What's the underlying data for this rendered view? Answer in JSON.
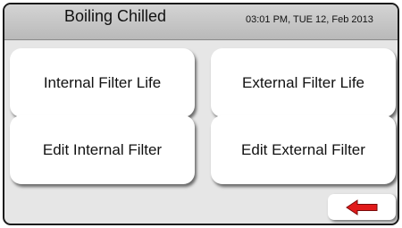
{
  "header": {
    "title": "Boiling Chilled",
    "datetime": "03:01 PM, TUE 12, Feb 2013"
  },
  "menu": {
    "internal_filter_life": "Internal Filter Life",
    "external_filter_life": "External Filter Life",
    "edit_internal_filter": "Edit Internal Filter",
    "edit_external_filter": "Edit External Filter"
  },
  "footer": {
    "back_icon": "arrow-left-icon",
    "back_icon_color": "#e11a1a"
  }
}
